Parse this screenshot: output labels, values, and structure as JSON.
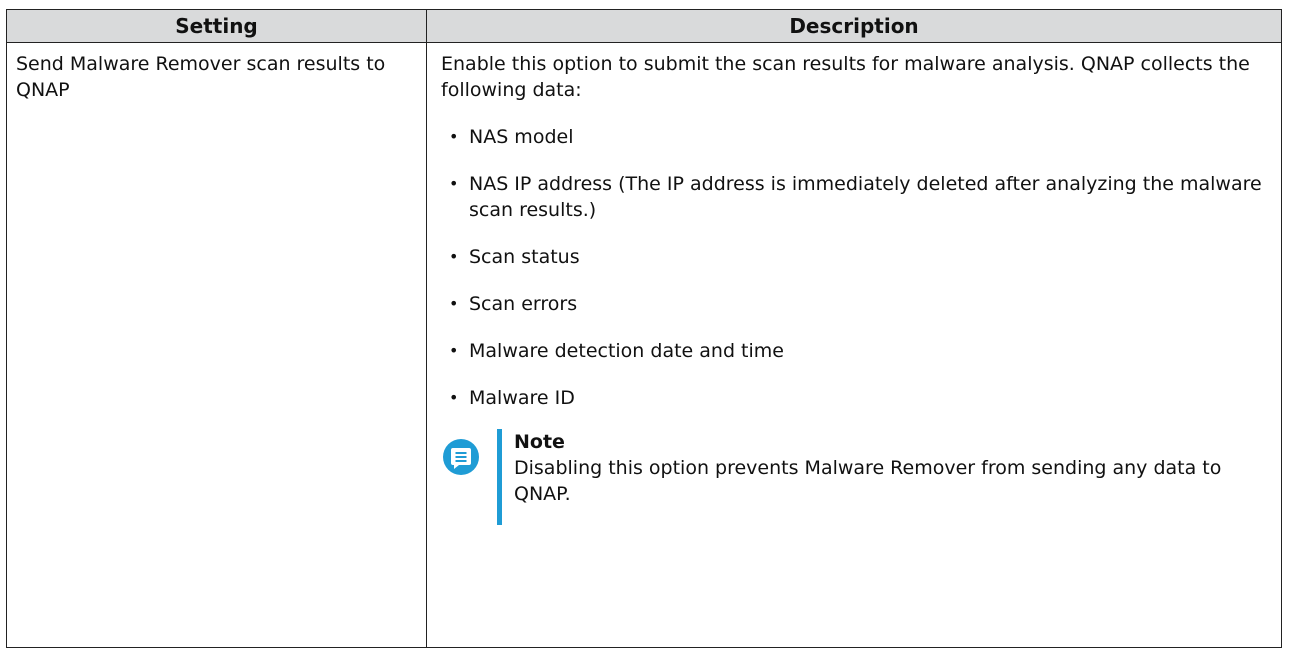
{
  "table": {
    "headers": {
      "setting": "Setting",
      "description": "Description"
    },
    "row": {
      "setting": "Send Malware Remover scan results to QNAP",
      "description_intro": "Enable this option to submit the scan results for malware analysis. QNAP collects the following data:",
      "bullets": [
        "NAS model",
        "NAS IP address (The IP address is immediately deleted after analyzing the malware scan results.)",
        "Scan status",
        "Scan errors",
        "Malware detection date and time",
        "Malware ID"
      ],
      "note": {
        "icon": "note-icon",
        "title": "Note",
        "text": "Disabling this option prevents Malware Remover from sending any data to QNAP."
      }
    }
  },
  "colors": {
    "header_background": "#d9dadb",
    "border": "#222222",
    "note_accent": "#1f9cd5"
  }
}
